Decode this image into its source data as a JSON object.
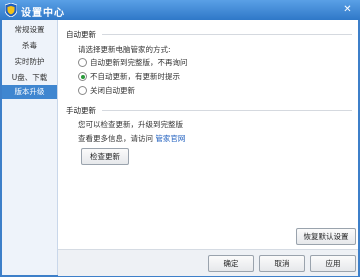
{
  "window": {
    "title": "设置中心",
    "close": "✕"
  },
  "sidebar": {
    "items": [
      {
        "label": "常规设置"
      },
      {
        "label": "杀毒"
      },
      {
        "label": "实时防护"
      },
      {
        "label": "U盘、下载"
      },
      {
        "label": "版本升级"
      }
    ]
  },
  "auto_update": {
    "title": "自动更新",
    "prompt": "请选择更新电脑管家的方式:",
    "options": [
      {
        "label": "自动更新到完整版，不再询问",
        "selected": false
      },
      {
        "label": "不自动更新，有更新时提示",
        "selected": true
      },
      {
        "label": "关闭自动更新",
        "selected": false
      }
    ]
  },
  "manual_update": {
    "title": "手动更新",
    "desc": "您可以检查更新，升级到完整版",
    "more_info_prefix": "查看更多信息，请访问",
    "more_info_link": "管家官网",
    "check_button": "检查更新"
  },
  "restore_default_button": "恢复默认设置",
  "footer": {
    "ok": "确定",
    "cancel": "取消",
    "apply": "应用"
  }
}
